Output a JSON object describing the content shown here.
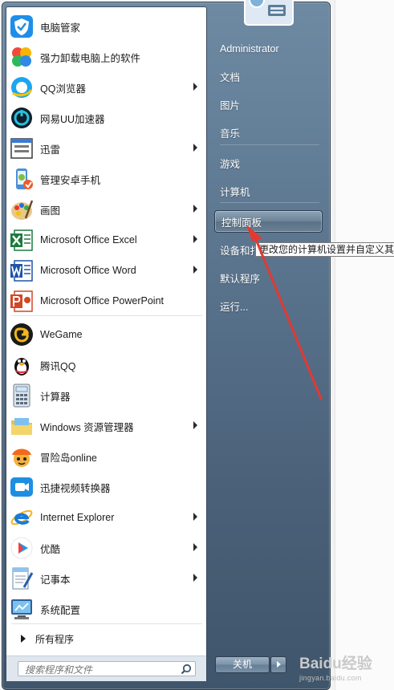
{
  "programs": [
    {
      "label": "电脑管家",
      "icon": "tencent-pc-manager-icon",
      "has_arrow": false
    },
    {
      "label": "强力卸载电脑上的软件",
      "icon": "uninstaller-icon",
      "has_arrow": false
    },
    {
      "label": "QQ浏览器",
      "icon": "qq-browser-icon",
      "has_arrow": true
    },
    {
      "label": "网易UU加速器",
      "icon": "uu-accelerator-icon",
      "has_arrow": false
    },
    {
      "label": "迅雷",
      "icon": "xunlei-icon",
      "has_arrow": true
    },
    {
      "label": "管理安卓手机",
      "icon": "android-manager-icon",
      "has_arrow": false
    },
    {
      "label": "画图",
      "icon": "paint-icon",
      "has_arrow": true
    },
    {
      "label": "Microsoft Office Excel",
      "icon": "excel-icon",
      "has_arrow": true
    },
    {
      "label": "Microsoft Office Word",
      "icon": "word-icon",
      "has_arrow": true
    },
    {
      "label": "Microsoft Office PowerPoint",
      "icon": "powerpoint-icon",
      "has_arrow": false
    },
    {
      "label": "WeGame",
      "icon": "wegame-icon",
      "has_arrow": false
    },
    {
      "label": "腾讯QQ",
      "icon": "qq-penguin-icon",
      "has_arrow": false
    },
    {
      "label": "计算器",
      "icon": "calculator-icon",
      "has_arrow": false
    },
    {
      "label": "Windows 资源管理器",
      "icon": "windows-explorer-icon",
      "has_arrow": true
    },
    {
      "label": "冒险岛online",
      "icon": "maplestory-icon",
      "has_arrow": false
    },
    {
      "label": "迅捷视频转换器",
      "icon": "video-converter-icon",
      "has_arrow": false
    },
    {
      "label": "Internet Explorer",
      "icon": "internet-explorer-icon",
      "has_arrow": true
    },
    {
      "label": "优酷",
      "icon": "youku-icon",
      "has_arrow": true
    },
    {
      "label": "记事本",
      "icon": "notepad-icon",
      "has_arrow": true
    },
    {
      "label": "系统配置",
      "icon": "system-config-icon",
      "has_arrow": false
    }
  ],
  "all_programs": "所有程序",
  "search": {
    "placeholder": "搜索程序和文件"
  },
  "right_items": [
    {
      "label": "Administrator"
    },
    {
      "label": "文档"
    },
    {
      "label": "图片"
    },
    {
      "label": "音乐"
    },
    {
      "label": "游戏"
    },
    {
      "label": "计算机"
    },
    {
      "label": "控制面板",
      "highlighted": true
    },
    {
      "label": "设备和打印机"
    },
    {
      "label": "默认程序"
    },
    {
      "label": "运行..."
    }
  ],
  "tooltip": "更改您的计算机设置并自定义其",
  "shutdown": {
    "label": "关机"
  },
  "annotation": {
    "color": "#e03a32"
  },
  "watermark": {
    "brand": "Baidu经验",
    "url": "jingyan.baidu.com"
  }
}
